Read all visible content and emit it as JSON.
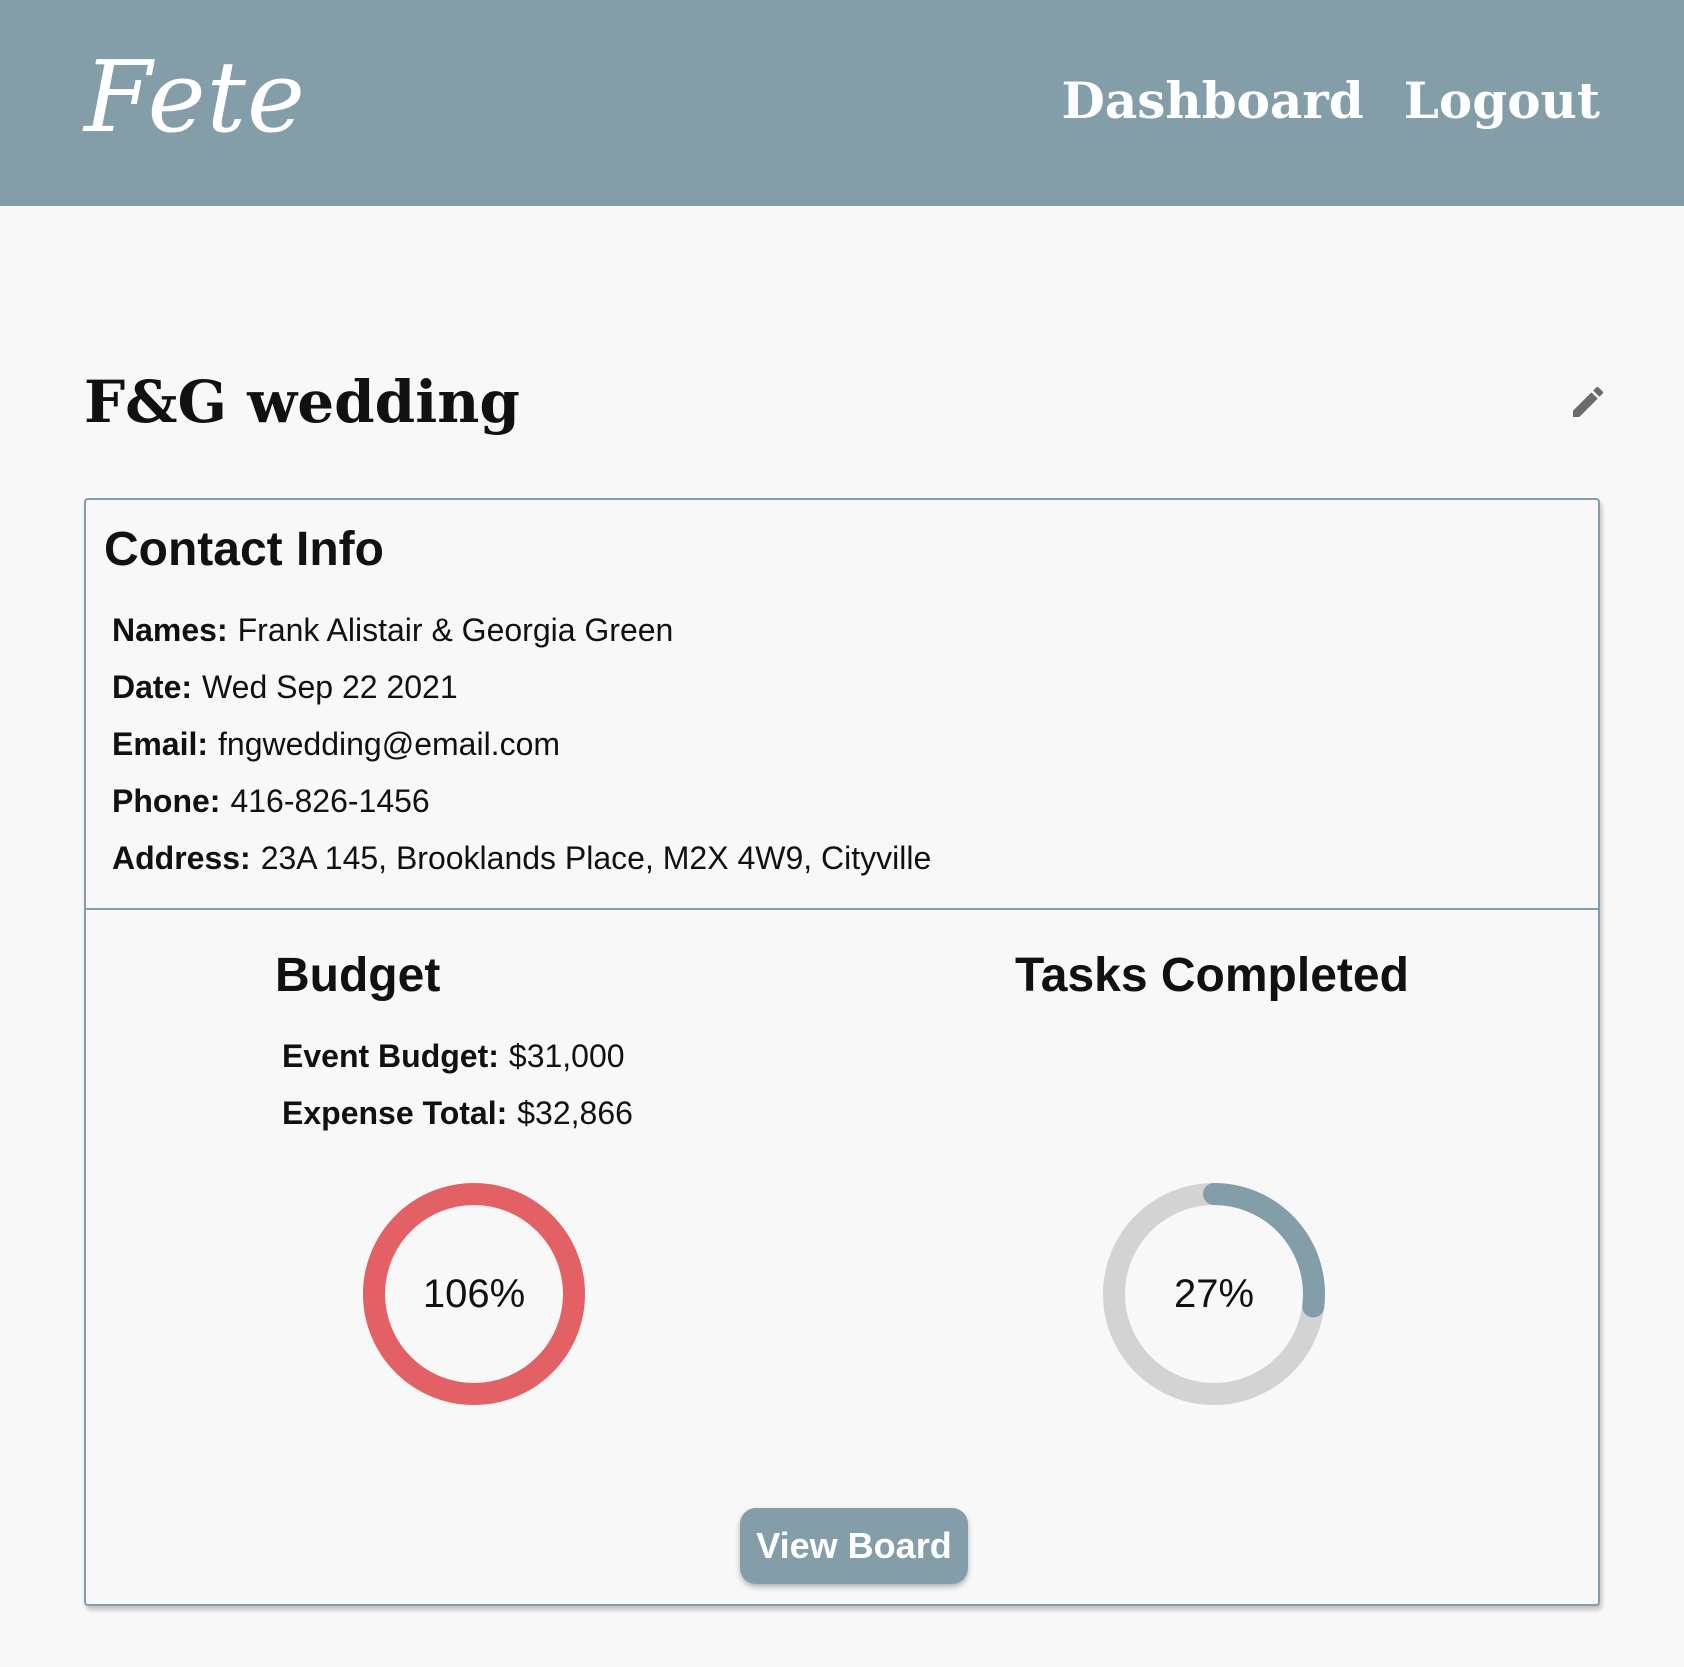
{
  "header": {
    "brand": "Fete",
    "nav": {
      "dashboard_label": "Dashboard",
      "logout_label": "Logout"
    }
  },
  "event": {
    "title": "F&G wedding",
    "edit_icon": "pencil-icon"
  },
  "contact": {
    "title": "Contact Info",
    "fields": {
      "names": {
        "label": "Names:",
        "value": "Frank Alistair & Georgia Green"
      },
      "date": {
        "label": "Date:",
        "value": "Wed Sep 22 2021"
      },
      "email": {
        "label": "Email:",
        "value": "fngwedding@email.com"
      },
      "phone": {
        "label": "Phone:",
        "value": "416-826-1456"
      },
      "address": {
        "label": "Address:",
        "value": "23A 145, Brooklands Place, M2X 4W9, Cityville"
      }
    }
  },
  "budget": {
    "title": "Budget",
    "event_budget": {
      "label": "Event Budget:",
      "value": "$31,000"
    },
    "expense_total": {
      "label": "Expense Total:",
      "value": "$32,866"
    },
    "percent_label": "106%",
    "percent": 106,
    "color": "#e36164"
  },
  "tasks": {
    "title": "Tasks Completed",
    "percent_label": "27%",
    "percent": 27,
    "color": "#849ea9",
    "track_color": "#d3d3d3"
  },
  "actions": {
    "view_board_label": "View Board"
  },
  "colors": {
    "accent": "#849ea9",
    "background": "#f8f8f8",
    "over_budget": "#e36164"
  }
}
